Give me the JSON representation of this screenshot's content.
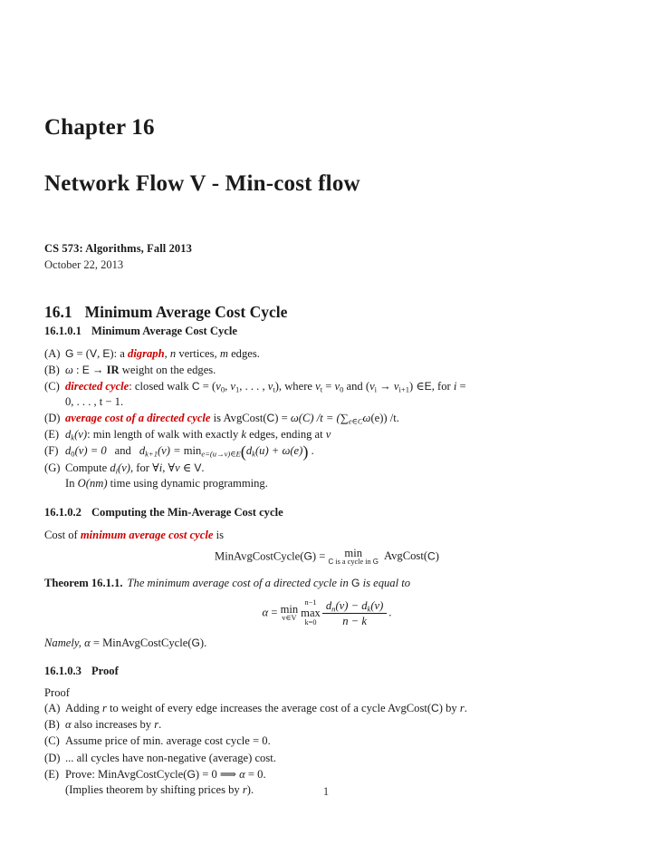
{
  "document": {
    "chapter_title": "Chapter 16",
    "title": "Network Flow V - Min-cost flow",
    "course": "CS 573: Algorithms, Fall 2013",
    "date": "October 22, 2013",
    "page_number": "1"
  },
  "section": {
    "number": "16.1",
    "title": "Minimum Average Cost Cycle"
  },
  "subsections": {
    "s1": {
      "number": "16.1.0.1",
      "title": "Minimum Average Cost Cycle"
    },
    "s2": {
      "number": "16.1.0.2",
      "title": "Computing the Min-Average Cost cycle"
    },
    "s3": {
      "number": "16.1.0.3",
      "title": "Proof"
    }
  },
  "list1": {
    "a": {
      "label": "(A)",
      "graph": "G",
      "eq": " = (",
      "v": "V",
      "comma": ", ",
      "e": "E",
      "close": "): a ",
      "emph": "digraph",
      "tail_1": ", ",
      "n": "n",
      "tail_2": " vertices, ",
      "m": "m",
      "tail_3": " edges."
    },
    "b": {
      "label": "(B)",
      "omega": "ω",
      "colon": " : ",
      "e": "E",
      "arrow": " → ",
      "reals": "IR",
      "tail": " weight on the edges."
    },
    "c": {
      "label": "(C)",
      "emph": "directed cycle",
      "tail_1": ": closed walk ",
      "cycle": "C",
      "eq": " = (",
      "v0": "v",
      "sub0": "0",
      "comma1": ", ",
      "v1": "v",
      "sub1": "1",
      "dots": ", . . . , ",
      "vt": "v",
      "subt": "t",
      "close": "), where ",
      "vt2": "v",
      "subt2": "t",
      "eqv0": " = ",
      "v02": "v",
      "sub02": "0",
      "and": " and (",
      "vi": "v",
      "subi": "i",
      "arrow": " → ",
      "vi1": "v",
      "subi1": "i+1",
      "paren": ") ",
      "in": "∈",
      "edges": "E",
      "for": ", for ",
      "i": "i",
      "eq2": " =",
      "cont": "0, . . . , t − 1."
    },
    "d": {
      "label": "(D)",
      "emph": "average cost of a directed cycle",
      "tail_1": " is AvgCost(",
      "cycle": "C",
      "tail_2": ") = ",
      "omega": "ω",
      "tail_3": "(C) /t = (",
      "sum": "∑",
      "sumsub": "e∈C",
      "omega2": "ω",
      "tail_4": "(e)) /t."
    },
    "e": {
      "label": "(E)",
      "d": "d",
      "sub": "k",
      "arg": "(v)",
      "tail_1": ": min length of walk with exactly ",
      "k": "k",
      "tail_2": " edges, ending at ",
      "v": "v"
    },
    "f": {
      "label": "(F)",
      "d0": "d",
      "sub0": "0",
      "arg0": "(v) = 0",
      "and": "and",
      "dk1": "d",
      "subk1": "k+1",
      "argk1": "(v) = ",
      "minname": "min",
      "minsub": "e=(u→v)∈E",
      "inner": "d",
      "innersub": "k",
      "innerarg": "(u) + ",
      "omega": "ω",
      "omegaarg": "(e)",
      "tail": " ."
    },
    "g": {
      "label": "(G)",
      "head": "Compute ",
      "d": "d",
      "sub": "i",
      "arg": "(v)",
      "tail_1": ", for ∀",
      "i": "i",
      "tail_2": ", ∀",
      "v": "v",
      "in": " ∈ ",
      "vset": "V",
      "tail_3": ".",
      "cont_1": "In ",
      "bigo": "O",
      "cont_2": "(nm)",
      "cont_3": " time using dynamic programming."
    }
  },
  "section2": {
    "cost_line_1": "Cost of ",
    "cost_emph": "minimum average cost cycle",
    "cost_line_2": " is",
    "equation": {
      "lhs": "MinAvgCostCycle(",
      "g": "G",
      "lhs_close": ") = ",
      "minname": "min",
      "minsub_pre": "C",
      "minsub_mid": " is a cycle in ",
      "minsub_post": "G",
      "rhs": "AvgCost(",
      "c": "C",
      "rhs_close": ")"
    }
  },
  "theorem": {
    "name": "Theorem 16.1.1.",
    "statement_1": "The minimum average cost of a directed cycle in ",
    "g": "G",
    "statement_2": " is equal to",
    "equation": {
      "alpha": "α",
      "eq": " = ",
      "minname": "min",
      "minsub": "v∈V",
      "maxname": "max",
      "maxsub": "k=0",
      "maxsup": "n−1",
      "num_dn": "d",
      "num_dn_sub": "n",
      "num_mid": "(v) − ",
      "num_dk": "d",
      "num_dk_sub": "k",
      "num_end": "(v)",
      "den": "n − k",
      "period": "."
    },
    "namely_1": "Namely, ",
    "namely_alpha": "α",
    "namely_2": " = MinAvgCostCycle(",
    "namely_g": "G",
    "namely_3": ")."
  },
  "proof": {
    "head": "Proof",
    "a": {
      "label": "(A)",
      "text_1": "Adding ",
      "r": "r",
      "text_2": " to weight of every edge increases the average cost of a cycle AvgCost(",
      "c": "C",
      "text_3": ") by ",
      "r2": "r",
      "text_4": "."
    },
    "b": {
      "label": "(B)",
      "alpha": "α",
      "text_1": " also increases by ",
      "r": "r",
      "text_2": "."
    },
    "c": {
      "label": "(C)",
      "text": "Assume price of min. average cost cycle = 0."
    },
    "d": {
      "label": "(D)",
      "text": "... all cycles have non-negative (average) cost."
    },
    "e": {
      "label": "(E)",
      "text_1": "Prove: MinAvgCostCycle(",
      "g": "G",
      "text_2": ") = 0 ",
      "implies": "⟹",
      "text_3": " ",
      "alpha": "α",
      "text_4": " = 0.",
      "cont_1": "(Implies theorem by shifting prices by ",
      "cont_r": "r",
      "cont_2": ")."
    }
  },
  "colors": {
    "emphasis_red": "#cc0000",
    "text": "#1a1a1a",
    "background": "#ffffff"
  }
}
